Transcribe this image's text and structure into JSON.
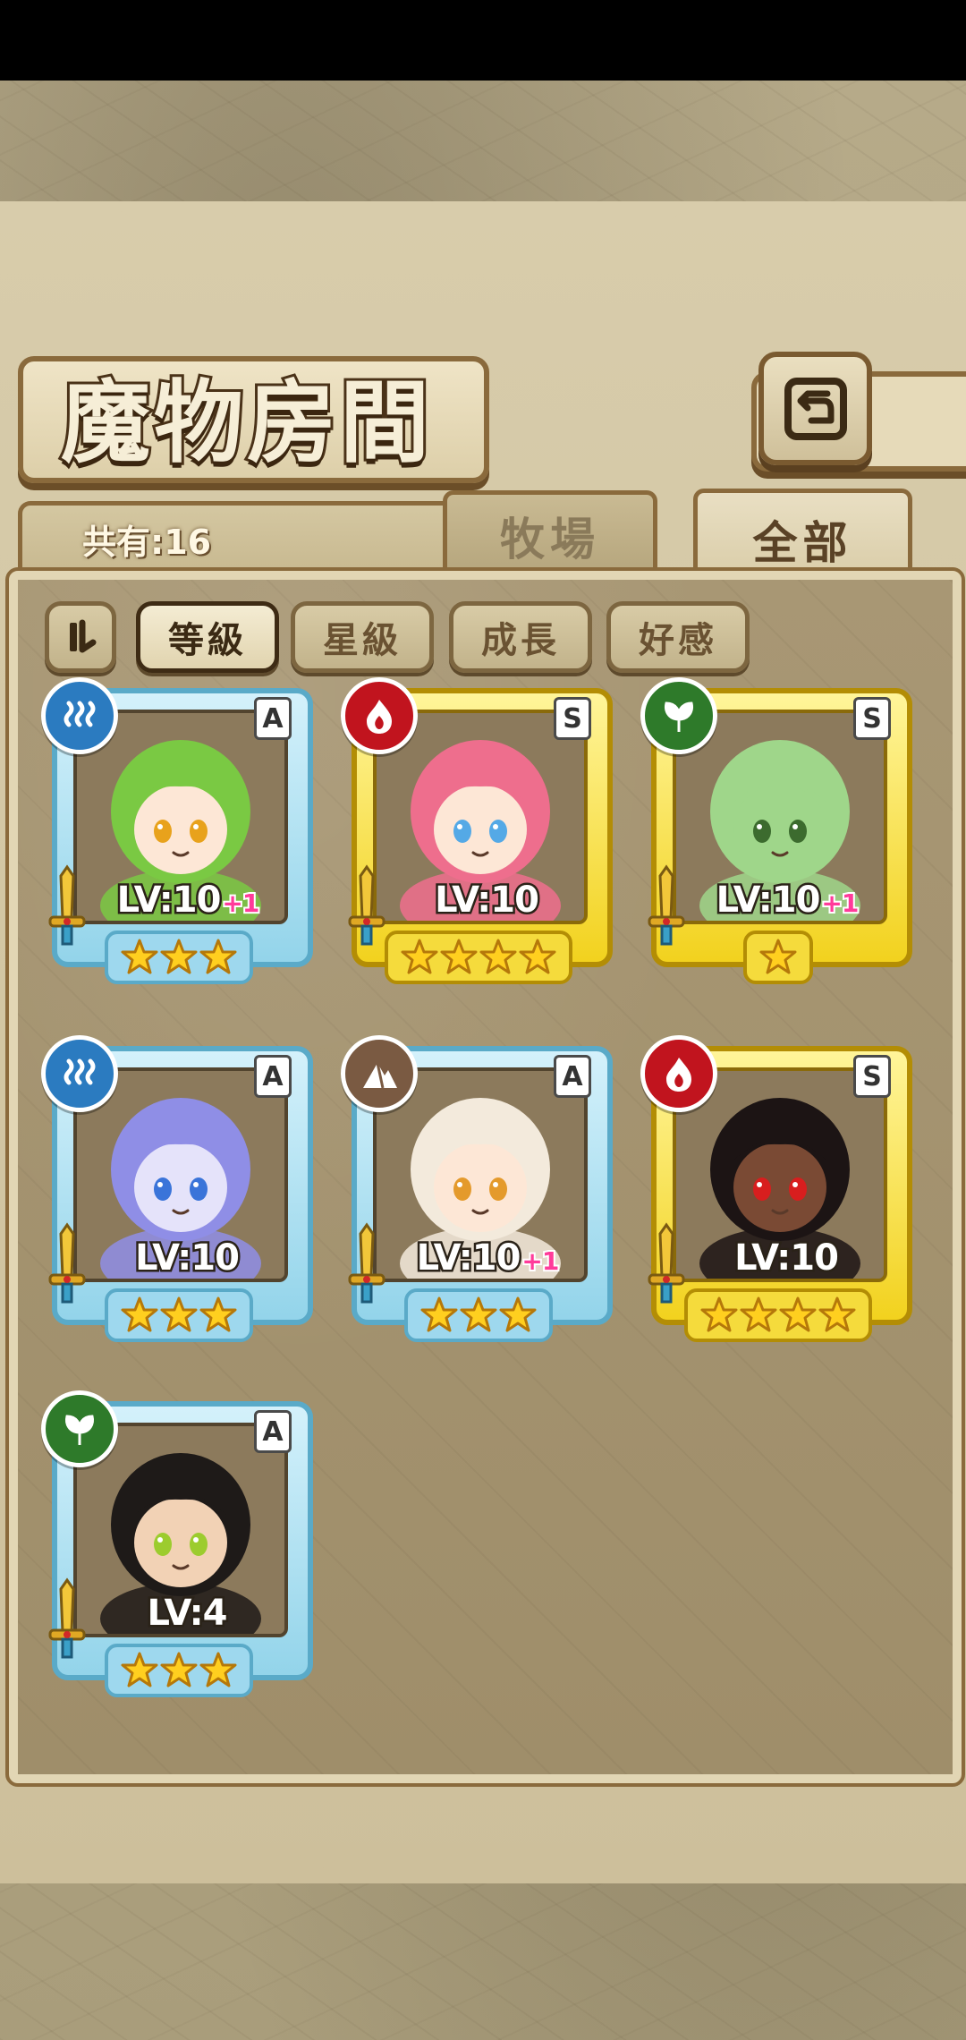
{
  "screen": {
    "title": "魔物房間",
    "count_label": "共有:16",
    "back_icon": "return-arrow-icon"
  },
  "tabs": [
    {
      "label": "牧場",
      "selected": false
    },
    {
      "label": "全部",
      "selected": true
    }
  ],
  "sort": {
    "toggle_icon": "sort-order-icon",
    "options": [
      {
        "label": "等級",
        "active": true
      },
      {
        "label": "星級",
        "active": false
      },
      {
        "label": "成長",
        "active": false
      },
      {
        "label": "好感",
        "active": false
      }
    ]
  },
  "monsters": [
    {
      "element": "water",
      "rank": "A",
      "level": "LV:10",
      "bonus": "+1",
      "stars": 3,
      "colors": {
        "hair": "#7ac943",
        "skin": "#fde7d6",
        "eyes": "#e8a21c"
      }
    },
    {
      "element": "fire",
      "rank": "S",
      "level": "LV:10",
      "bonus": "",
      "stars": 4,
      "colors": {
        "hair": "#ee6e8d",
        "skin": "#fde7d6",
        "eyes": "#54a9e6"
      }
    },
    {
      "element": "wood",
      "rank": "S",
      "level": "LV:10",
      "bonus": "+1",
      "stars": 1,
      "colors": {
        "hair": "#9fd68a",
        "skin": "#9fd68a",
        "eyes": "#3c6b2e"
      }
    },
    {
      "element": "water",
      "rank": "A",
      "level": "LV:10",
      "bonus": "",
      "stars": 3,
      "colors": {
        "hair": "#8f8ee6",
        "skin": "#e5e3fa",
        "eyes": "#3a74d9"
      }
    },
    {
      "element": "earth",
      "rank": "A",
      "level": "LV:10",
      "bonus": "+1",
      "stars": 3,
      "colors": {
        "hair": "#f3eadc",
        "skin": "#fde7d6",
        "eyes": "#e49a2c"
      }
    },
    {
      "element": "fire",
      "rank": "S",
      "level": "LV:10",
      "bonus": "",
      "stars": 4,
      "colors": {
        "hair": "#1c1414",
        "skin": "#7a4a34",
        "eyes": "#d81e1e"
      }
    },
    {
      "element": "wood",
      "rank": "A",
      "level": "LV:4",
      "bonus": "",
      "stars": 3,
      "colors": {
        "hair": "#1e1a18",
        "skin": "#f2d2b5",
        "eyes": "#9ccc2e"
      }
    }
  ]
}
